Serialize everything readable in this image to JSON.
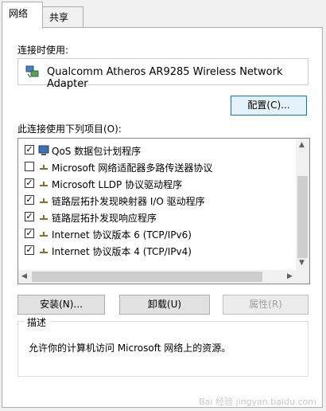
{
  "tabs": [
    {
      "label": "网络"
    },
    {
      "label": "共享"
    }
  ],
  "connect_using_label": "连接时使用:",
  "adapter_name": "Qualcomm Atheros AR9285 Wireless Network Adapter",
  "configure_button": "配置(C)...",
  "items_label": "此连接使用下列项目(O):",
  "items": [
    {
      "label": "QoS 数据包计划程序",
      "checked": true
    },
    {
      "label": "Microsoft 网络适配器多路传送器协议",
      "checked": false
    },
    {
      "label": "Microsoft LLDP 协议驱动程序",
      "checked": true
    },
    {
      "label": "链路层拓扑发现映射器 I/O 驱动程序",
      "checked": true
    },
    {
      "label": "链路层拓扑发现响应程序",
      "checked": true
    },
    {
      "label": "Internet 协议版本 6 (TCP/IPv6)",
      "checked": true
    },
    {
      "label": "Internet 协议版本 4 (TCP/IPv4)",
      "checked": true
    }
  ],
  "buttons": {
    "install": "安装(N)...",
    "uninstall": "卸载(U)",
    "properties": "属性(R)"
  },
  "description_title": "描述",
  "description_text": "允许你的计算机访问 Microsoft 网络上的资源。",
  "watermark": "Bai 经验 jingyan.baidu.com"
}
